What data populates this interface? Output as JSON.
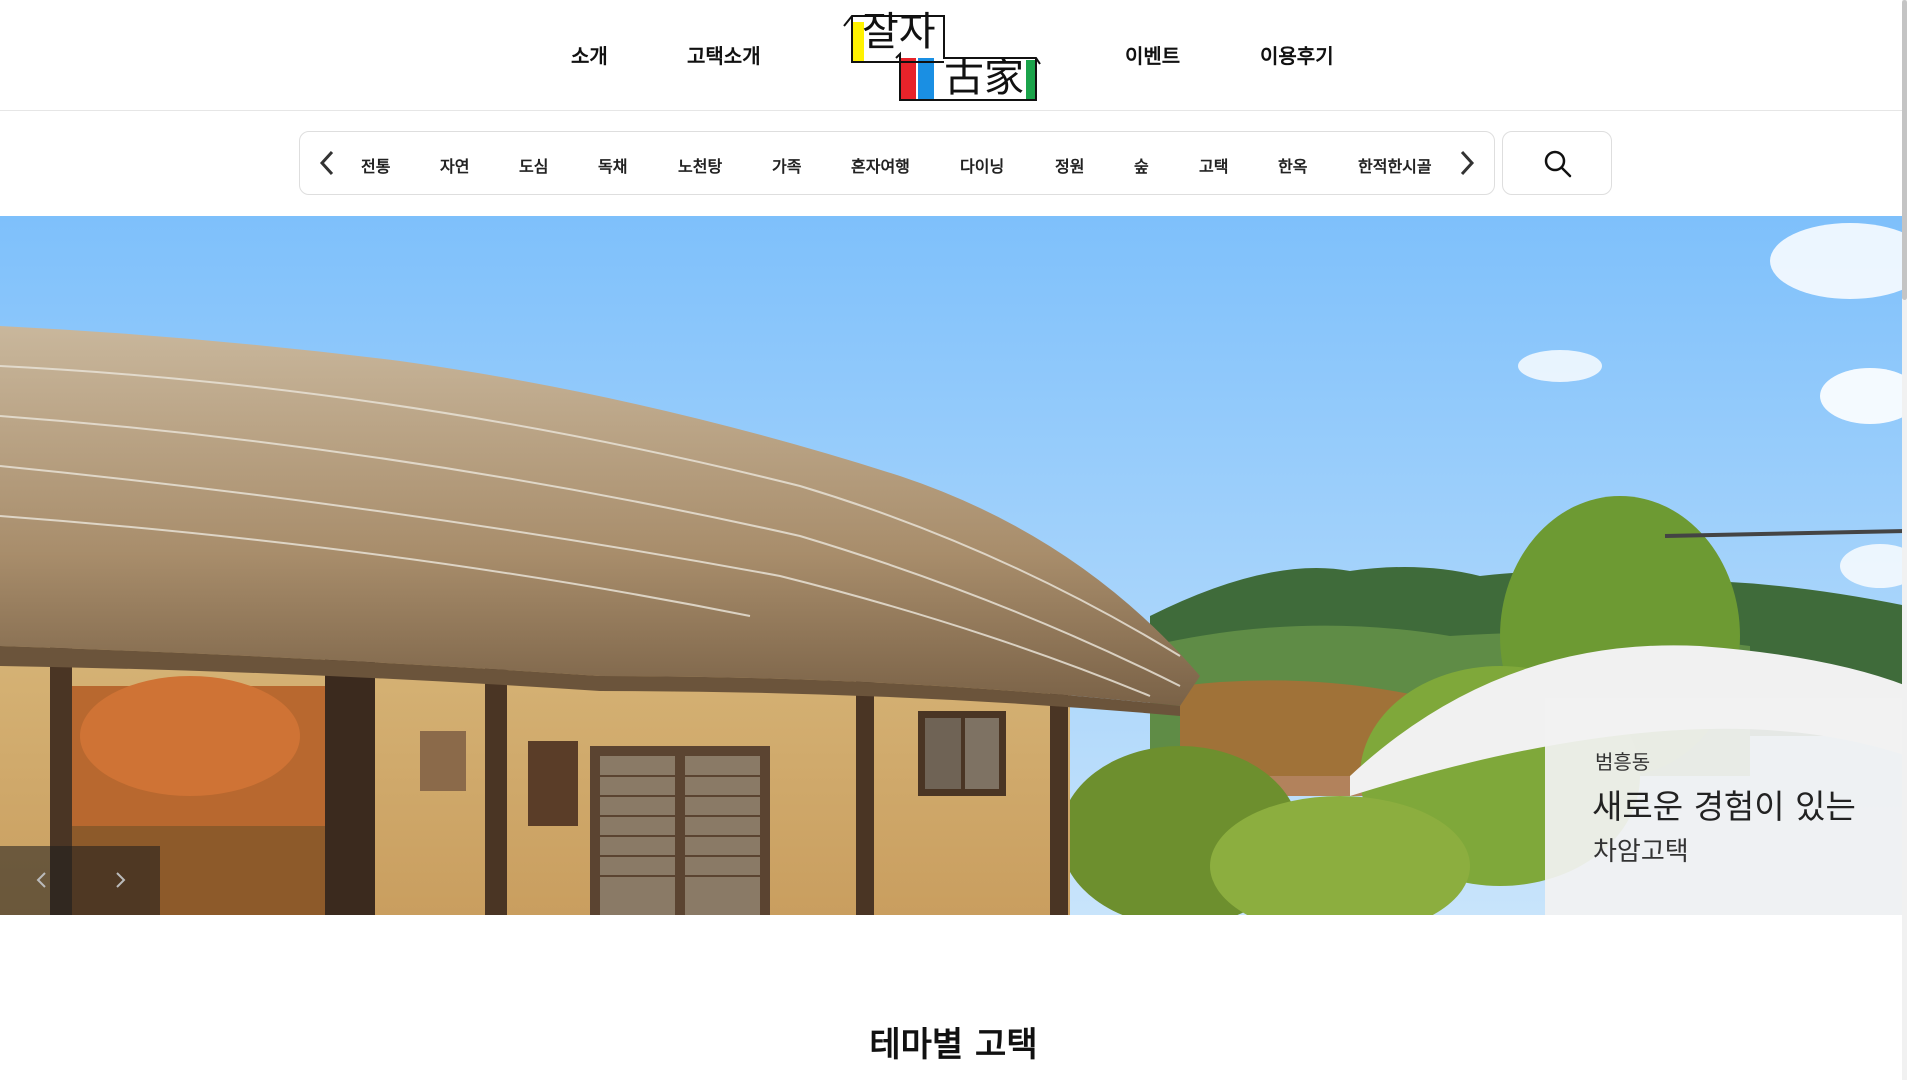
{
  "header": {
    "nav_left": [
      "소개",
      "고택소개"
    ],
    "nav_right": [
      "이벤트",
      "이용후기"
    ],
    "logo": {
      "line1": "잘자",
      "line2": "古家"
    }
  },
  "categories": {
    "items": [
      "전통",
      "자연",
      "도심",
      "독채",
      "노천탕",
      "가족",
      "혼자여행",
      "다이닝",
      "정원",
      "숲",
      "고택",
      "한옥",
      "한적한시골"
    ],
    "prev_icon": "chevron-left-icon",
    "next_icon": "chevron-right-icon",
    "search_icon": "search-icon"
  },
  "hero": {
    "location": "범흥동",
    "title": "새로운 경험이 있는",
    "subtitle": "차암고택",
    "prev_icon": "chevron-left-icon",
    "next_icon": "chevron-right-icon"
  },
  "section": {
    "title": "테마별 고택"
  },
  "colors": {
    "logo_yellow": "#fff200",
    "logo_red": "#e8232a",
    "logo_blue": "#1a8fe3",
    "logo_green": "#1aa34a",
    "sky": "#9fd0fb"
  }
}
